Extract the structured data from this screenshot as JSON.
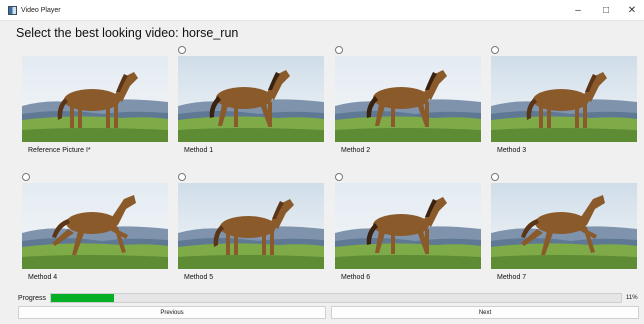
{
  "window": {
    "title": "Video Player",
    "minimize_icon": "minimize-icon",
    "maximize_icon": "maximize-icon",
    "close_icon": "close-icon"
  },
  "heading": "Select the best looking video: horse_run",
  "items": [
    {
      "caption": "Reference Picture I*",
      "has_radio": false,
      "pose": "stand"
    },
    {
      "caption": "Method 1",
      "has_radio": true,
      "pose": "walk"
    },
    {
      "caption": "Method 2",
      "has_radio": true,
      "pose": "walk"
    },
    {
      "caption": "Method 3",
      "has_radio": true,
      "pose": "stand"
    },
    {
      "caption": "Method 4",
      "has_radio": true,
      "pose": "gallop"
    },
    {
      "caption": "Method 5",
      "has_radio": true,
      "pose": "stand"
    },
    {
      "caption": "Method 6",
      "has_radio": true,
      "pose": "walk"
    },
    {
      "caption": "Method 7",
      "has_radio": true,
      "pose": "gallop"
    }
  ],
  "progress": {
    "label": "Progress",
    "value": 11,
    "text": "11%",
    "fill_color": "#06b025"
  },
  "buttons": {
    "previous": "Previous",
    "next": "Next"
  }
}
